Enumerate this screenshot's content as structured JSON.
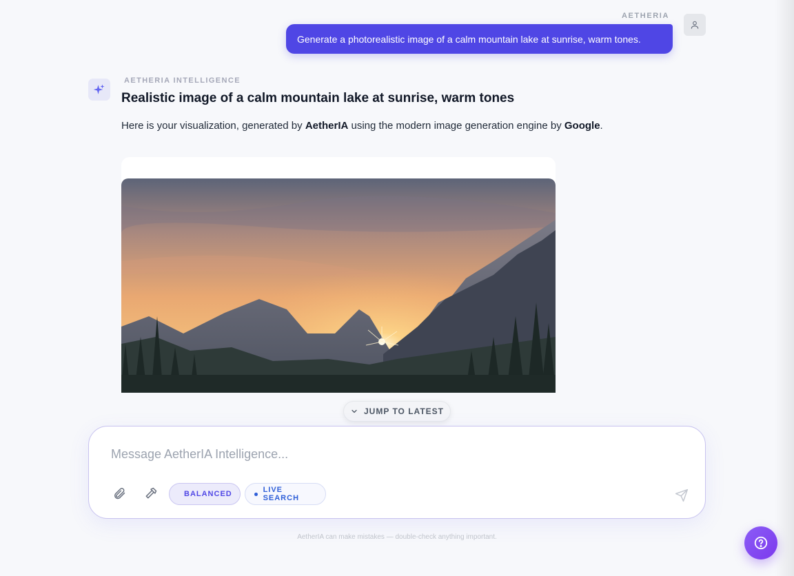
{
  "user": {
    "label": "AETHERIA",
    "message": "Generate a photorealistic image of a calm mountain lake at sunrise, warm tones.",
    "avatar_icon": "user-icon"
  },
  "assistant": {
    "label": "AETHERIA INTELLIGENCE",
    "avatar_icon": "sparkle-icon",
    "title": "Realistic image of a calm mountain lake at sunrise, warm tones",
    "text_prefix": "Here is your visualization, generated by ",
    "brand": "AetherIA",
    "text_middle": " using the modern image generation engine by ",
    "engine": "Google",
    "text_suffix": ".",
    "image_alt": "mountain-lake-sunrise-image"
  },
  "jump": {
    "label": "JUMP TO LATEST",
    "icon": "chevron-down-icon"
  },
  "composer": {
    "placeholder": "Message AetherIA Intelligence...",
    "value": "",
    "attach_icon": "paperclip-icon",
    "tools_icon": "hammer-icon",
    "mode_chip": "BALANCED",
    "search_chip": "LIVE SEARCH",
    "send_icon": "send-icon"
  },
  "footer": {
    "disclaimer": "AetherIA can make mistakes — double-check anything important.",
    "help_icon": "help-icon"
  },
  "colors": {
    "accent": "#4f46e5",
    "help": "#7c3aed",
    "background": "#f7f8fb"
  }
}
